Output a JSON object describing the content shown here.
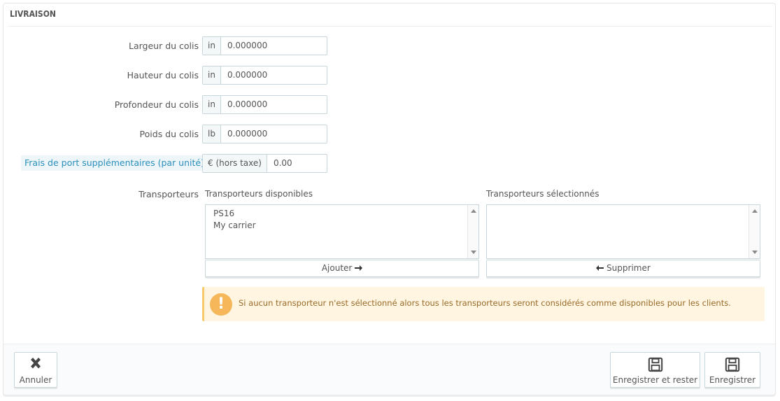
{
  "panel": {
    "title": "LIVRAISON"
  },
  "fields": [
    {
      "label": "Largeur du colis",
      "unit": "in",
      "value": "0.000000"
    },
    {
      "label": "Hauteur du colis",
      "unit": "in",
      "value": "0.000000"
    },
    {
      "label": "Profondeur du colis",
      "unit": "in",
      "value": "0.000000"
    },
    {
      "label": "Poids du colis",
      "unit": "lb",
      "value": "0.000000"
    },
    {
      "label": "Frais de port supplémentaires (par unité)",
      "unit": "€ (hors taxe)",
      "value": "0.00"
    }
  ],
  "carriers": {
    "label": "Transporteurs",
    "available_title": "Transporteurs disponibles",
    "selected_title": "Transporteurs sélectionnés",
    "available": [
      "PS16",
      "My carrier"
    ],
    "selected": [],
    "add_label": "Ajouter",
    "remove_label": "Supprimer"
  },
  "alert": {
    "text": "Si aucun transporteur n'est sélectionné alors tous les transporteurs seront considérés comme disponibles pour les clients."
  },
  "footer": {
    "cancel_label": "Annuler",
    "save_stay_label": "Enregistrer et rester",
    "save_label": "Enregistrer"
  },
  "colors": {
    "accent": "#2a8fbd",
    "warning_bg": "#fff5e0",
    "warning_icon": "#f6b75a"
  }
}
